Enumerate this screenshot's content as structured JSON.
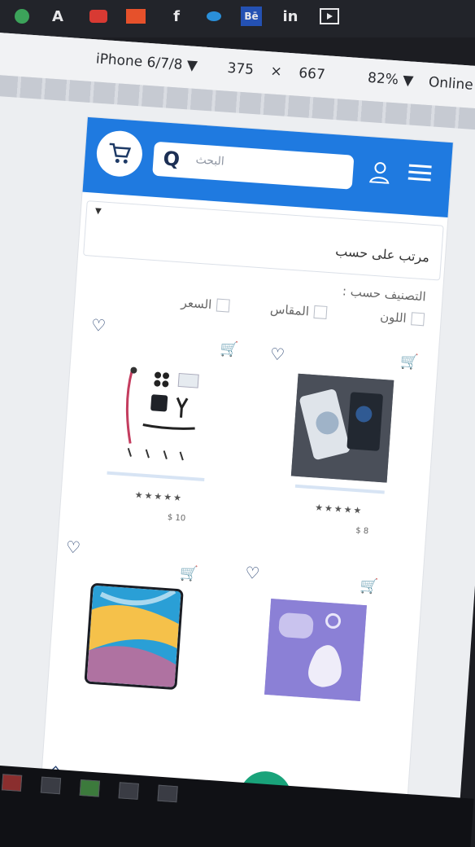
{
  "bookmarks": [
    "A",
    "f",
    "in",
    "Bē"
  ],
  "device_bar": {
    "device": "iPhone 6/7/8 ▼",
    "width": "375",
    "times": "×",
    "height": "667",
    "zoom": "82% ▼",
    "network": "Online ▼"
  },
  "header": {
    "search_placeholder": "البحث",
    "search_icon": "Q"
  },
  "sort": {
    "label": "مرتب على حسب",
    "caret": "▼"
  },
  "filters": {
    "title": "التصنيف حسب :",
    "options": [
      "اللون",
      "المقاس",
      "السعر"
    ]
  },
  "products": [
    {
      "price": "$ 8",
      "rating": "★★★★★"
    },
    {
      "price": "$ 10",
      "rating": "★★★★★"
    },
    {
      "price": "",
      "rating": ""
    },
    {
      "price": "",
      "rating": ""
    }
  ],
  "colors": {
    "brand": "#1f7ae0",
    "accent": "#19a37a",
    "icon": "#1f3b6b"
  }
}
